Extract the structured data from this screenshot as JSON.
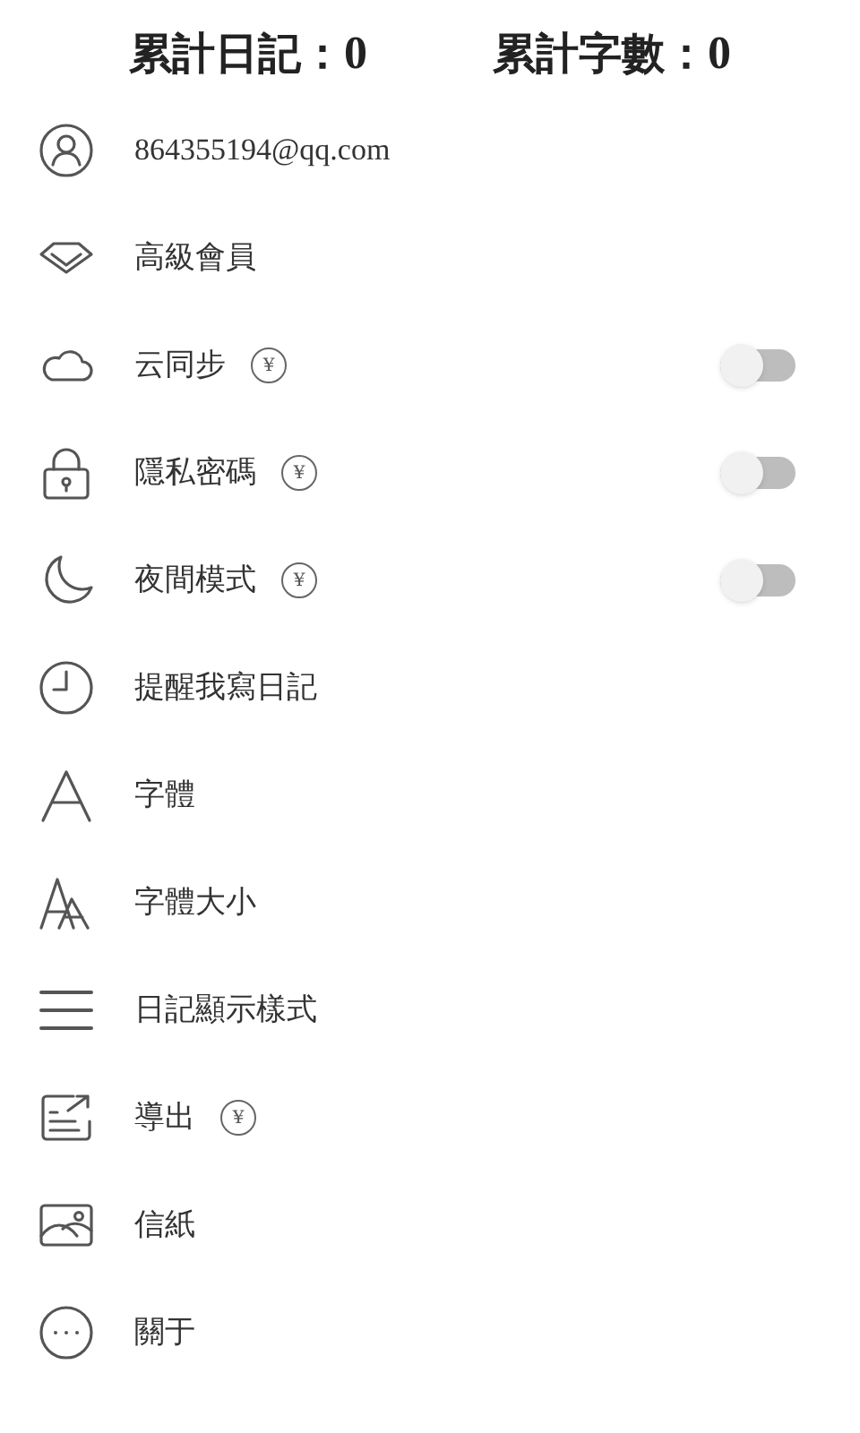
{
  "stats": [
    {
      "label": "累計日記：",
      "value": "0"
    },
    {
      "label": "累計字數：",
      "value": "0"
    }
  ],
  "menu": [
    {
      "kind": "plain",
      "label": "864355194@qq.com"
    },
    {
      "kind": "plain",
      "label": "高級會員"
    },
    {
      "kind": "toggle",
      "label": "云同步",
      "badge": "¥",
      "on": false
    },
    {
      "kind": "toggle",
      "label": "隱私密碼",
      "badge": "¥",
      "on": false
    },
    {
      "kind": "toggle",
      "label": "夜間模式",
      "badge": "¥",
      "on": false
    },
    {
      "kind": "plain",
      "label": "提醒我寫日記"
    },
    {
      "kind": "plain",
      "label": "字體"
    },
    {
      "kind": "plain",
      "label": "字體大小"
    },
    {
      "kind": "plain",
      "label": "日記顯示樣式"
    },
    {
      "kind": "plain",
      "label": "導出",
      "badge": "¥"
    },
    {
      "kind": "plain",
      "label": "信紙"
    },
    {
      "kind": "plain",
      "label": "關于"
    }
  ]
}
